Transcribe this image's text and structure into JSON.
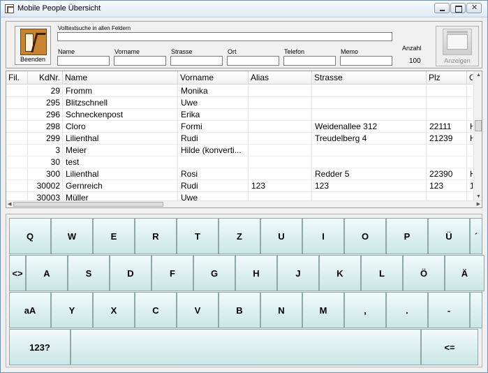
{
  "window": {
    "title": "Mobile People Übersicht"
  },
  "header": {
    "quit_label": "Beenden",
    "fulltext_label": "Volltextsuche in allen Feldern",
    "fulltext_value": "",
    "fields": [
      {
        "label": "Name",
        "value": ""
      },
      {
        "label": "Vorname",
        "value": ""
      },
      {
        "label": "Strasse",
        "value": ""
      },
      {
        "label": "Ort",
        "value": ""
      },
      {
        "label": "Telefon",
        "value": ""
      },
      {
        "label": "Memo",
        "value": ""
      }
    ],
    "count_label": "Anzahl",
    "count_value": "100",
    "show_label": "Anzeigen"
  },
  "table": {
    "columns": [
      "Fil.",
      "KdNr.",
      "Name",
      "Vorname",
      "Alias",
      "Strasse",
      "Plz",
      "O"
    ],
    "rows": [
      [
        "",
        "29",
        "Fromm",
        "Monika",
        "",
        "",
        "",
        ""
      ],
      [
        "",
        "295",
        "Blitzschnell",
        "Uwe",
        "",
        "",
        "",
        ""
      ],
      [
        "",
        "296",
        "Schneckenpost",
        "Erika",
        "",
        "",
        "",
        ""
      ],
      [
        "",
        "298",
        "Cloro",
        "Formi",
        "",
        "Weidenallee 312",
        "22111",
        "H"
      ],
      [
        "",
        "299",
        "Lilienthal",
        "Rudi",
        "",
        "Treudelberg 4",
        "21239",
        "H"
      ],
      [
        "",
        "3",
        "Meier",
        "Hilde (konverti...",
        "",
        "",
        "",
        ""
      ],
      [
        "",
        "30",
        "test",
        "",
        "",
        "",
        "",
        ""
      ],
      [
        "",
        "300",
        "Lilienthal",
        "Rosi",
        "",
        "Redder 5",
        "22390",
        "H"
      ],
      [
        "",
        "30002",
        "Gernreich",
        "Rudi",
        "123",
        "123",
        "123",
        "1"
      ],
      [
        "",
        "30003",
        "Müller",
        "Uwe",
        "",
        "",
        "",
        ""
      ]
    ]
  },
  "keyboard": {
    "row1": [
      "Q",
      "W",
      "E",
      "R",
      "T",
      "Z",
      "U",
      "I",
      "O",
      "P",
      "Ü",
      "´"
    ],
    "row2": [
      "<>",
      "A",
      "S",
      "D",
      "F",
      "G",
      "H",
      "J",
      "K",
      "L",
      "Ö",
      "Ä"
    ],
    "row3": [
      "aA",
      "Y",
      "X",
      "C",
      "V",
      "B",
      "N",
      "M",
      ",",
      ".",
      "-",
      ""
    ],
    "row4": [
      "123?",
      "",
      "<="
    ]
  }
}
